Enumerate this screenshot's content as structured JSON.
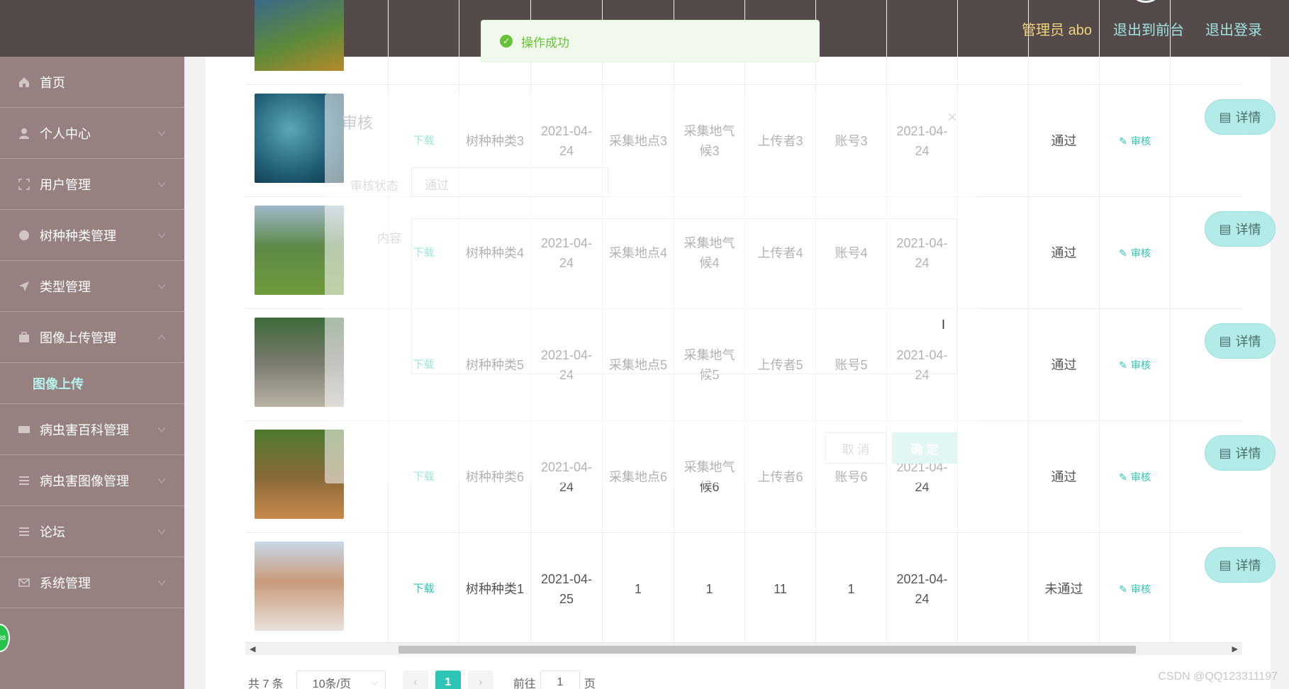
{
  "header": {
    "admin_label": "管理员 abo",
    "to_front": "退出到前台",
    "logout": "退出登录"
  },
  "toast": {
    "message": "操作成功"
  },
  "sidebar": {
    "items": [
      {
        "label": "首页",
        "icon": "home-icon"
      },
      {
        "label": "个人中心",
        "icon": "user-icon"
      },
      {
        "label": "用户管理",
        "icon": "frame-icon"
      },
      {
        "label": "树种种类管理",
        "icon": "globe-icon"
      },
      {
        "label": "类型管理",
        "icon": "send-icon"
      },
      {
        "label": "图像上传管理",
        "icon": "briefcase-icon"
      }
    ],
    "submenu_active": "图像上传",
    "items2": [
      {
        "label": "病虫害百科管理",
        "icon": "film-icon"
      },
      {
        "label": "病虫害图像管理",
        "icon": "list-icon"
      },
      {
        "label": "论坛",
        "icon": "list-icon"
      },
      {
        "label": "系统管理",
        "icon": "mail-icon"
      }
    ],
    "bubble": "38"
  },
  "dialog": {
    "title": "审核",
    "status_label": "审核状态",
    "status_value": "通过",
    "content_label": "内容",
    "cancel": "取 消",
    "confirm": "确 定"
  },
  "table": {
    "download_label": "下载",
    "audit_label": "审核",
    "detail_label": "详情",
    "rows": [
      {
        "image": "dolphin",
        "type": "树种种类3",
        "date": "2021-04-24",
        "place": "采集地点3",
        "climate": "采集地气候3",
        "uploader": "上传者3",
        "account": "账号3",
        "date2": "2021-04-24",
        "status": "通过"
      },
      {
        "image": "giraffe",
        "type": "树种种类4",
        "date": "2021-04-24",
        "place": "采集地点4",
        "climate": "采集地气候4",
        "uploader": "上传者4",
        "account": "账号4",
        "date2": "2021-04-24",
        "status": "通过"
      },
      {
        "image": "elephant",
        "type": "树种种类5",
        "date": "2021-04-24",
        "place": "采集地点5",
        "climate": "采集地气候5",
        "uploader": "上传者5",
        "account": "账号5",
        "date2": "2021-04-24",
        "status": "通过"
      },
      {
        "image": "deer",
        "type": "树种种类6",
        "date": "2021-04-24",
        "place": "采集地点6",
        "climate": "采集地气候6",
        "uploader": "上传者6",
        "account": "账号6",
        "date2": "2021-04-24",
        "status": "通过"
      },
      {
        "image": "girl",
        "type": "树种种类1",
        "date": "2021-04-25",
        "place": "1",
        "climate": "1",
        "uploader": "11",
        "account": "1",
        "date2": "2021-04-24",
        "status": "未通过"
      }
    ]
  },
  "pagination": {
    "total": "共 7 条",
    "page_size": "10条/页",
    "current": "1",
    "goto_label": "前往",
    "goto_value": "1",
    "page_suffix": "页"
  },
  "watermark": "CSDN @QQ123311197",
  "colors": {
    "topbar": "#554a4a",
    "sidebar": "#978180",
    "accent": "#2ec5b6",
    "admin": "#f0d27a",
    "toast_green": "#67c23a"
  }
}
